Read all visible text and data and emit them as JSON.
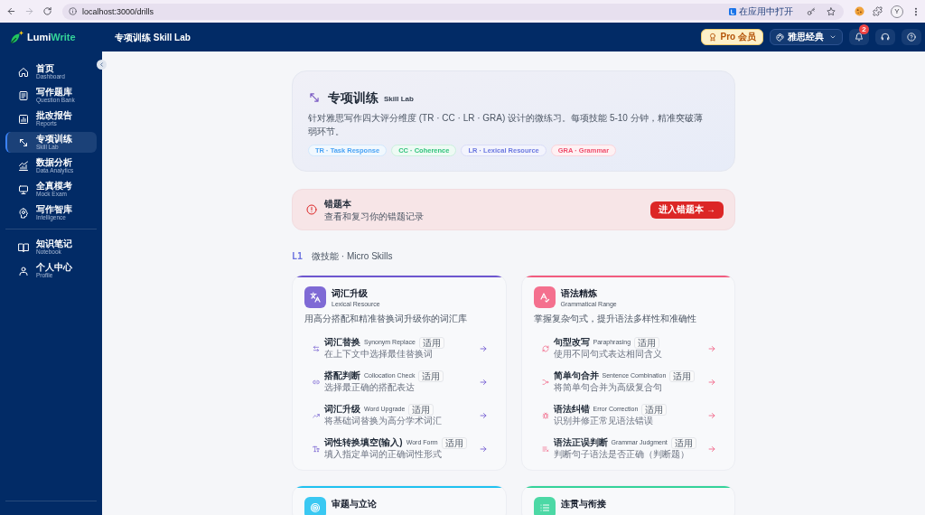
{
  "browser": {
    "url": "localhost:3000/drills",
    "open_in_app": "在应用中打开",
    "profile_initial": "Y"
  },
  "header": {
    "logo_primary": "Lumi",
    "logo_accent": "Write",
    "title": "专项训练 Skill Lab",
    "pro_button": "Pro 会员",
    "exam_select": "雅思经典",
    "notification_count": "2"
  },
  "sidebar": {
    "items": [
      {
        "label": "首页",
        "sublabel": "Dashboard",
        "selected": false
      },
      {
        "label": "写作题库",
        "sublabel": "Question Bank",
        "selected": false
      },
      {
        "label": "批改报告",
        "sublabel": "Reports",
        "selected": false
      },
      {
        "label": "专项训练",
        "sublabel": "Skill Lab",
        "selected": true
      },
      {
        "label": "数据分析",
        "sublabel": "Data Analytics",
        "selected": false
      },
      {
        "label": "全真模考",
        "sublabel": "Mock Exam",
        "selected": false
      },
      {
        "label": "写作智库",
        "sublabel": "Intelligence",
        "selected": false
      }
    ],
    "bottom_items": [
      {
        "label": "知识笔记",
        "sublabel": "Notebook",
        "selected": false
      },
      {
        "label": "个人中心",
        "sublabel": "Profile",
        "selected": false
      }
    ]
  },
  "hero": {
    "title": "专项训练",
    "subtitle": "Skill Lab",
    "description": "针对雅思写作四大评分维度 (TR · CC · LR · GRA) 设计的微练习。每项技能 5-10 分钟，精准突破薄弱环节。",
    "tags": [
      {
        "label": "TR · Task Response",
        "color": "#4aa3f5"
      },
      {
        "label": "CC · Coherence",
        "color": "#2fc27a"
      },
      {
        "label": "LR · Lexical Resource",
        "color": "#6b78e0"
      },
      {
        "label": "GRA · Grammar",
        "color": "#f0506e"
      }
    ]
  },
  "mistake_book": {
    "title": "错题本",
    "description": "查看和复习你的错题记录",
    "button": "进入错题本 →"
  },
  "section": {
    "level": "L1",
    "title": "微技能 · Micro Skills"
  },
  "cards": [
    {
      "title": "词汇升级",
      "subtitle": "Lexical Resource",
      "color": "#6e56cf",
      "description": "用高分搭配和精准替换词升级你的词汇库",
      "drills": [
        {
          "title": "词汇替换",
          "subtitle": "Synonym Replace",
          "badge": "适用",
          "description": "在上下文中选择最佳替换词"
        },
        {
          "title": "搭配判断",
          "subtitle": "Collocation Check",
          "badge": "适用",
          "description": "选择最正确的搭配表达"
        },
        {
          "title": "词汇升级",
          "subtitle": "Word Upgrade",
          "badge": "适用",
          "description": "将基础词替换为高分学术词汇"
        },
        {
          "title": "词性转换填空(输入)",
          "subtitle": "Word Form",
          "badge": "适用",
          "description": "填入指定单词的正确词性形式"
        }
      ]
    },
    {
      "title": "语法精炼",
      "subtitle": "Grammatical Range",
      "color": "#f25c7f",
      "description": "掌握复杂句式，提升语法多样性和准确性",
      "drills": [
        {
          "title": "句型改写",
          "subtitle": "Paraphrasing",
          "badge": "适用",
          "description": "使用不同句式表达相同含义"
        },
        {
          "title": "简单句合并",
          "subtitle": "Sentence Combination",
          "badge": "适用",
          "description": "将简单句合并为高级复合句"
        },
        {
          "title": "语法纠错",
          "subtitle": "Error Correction",
          "badge": "适用",
          "description": "识别并修正常见语法错误"
        },
        {
          "title": "语法正误判断",
          "subtitle": "Grammar Judgment",
          "badge": "适用",
          "description": "判断句子语法是否正确（判断题）"
        }
      ]
    },
    {
      "title": "审题与立论",
      "color": "#1fc1f0"
    },
    {
      "title": "连贯与衔接",
      "color": "#34d399"
    }
  ]
}
